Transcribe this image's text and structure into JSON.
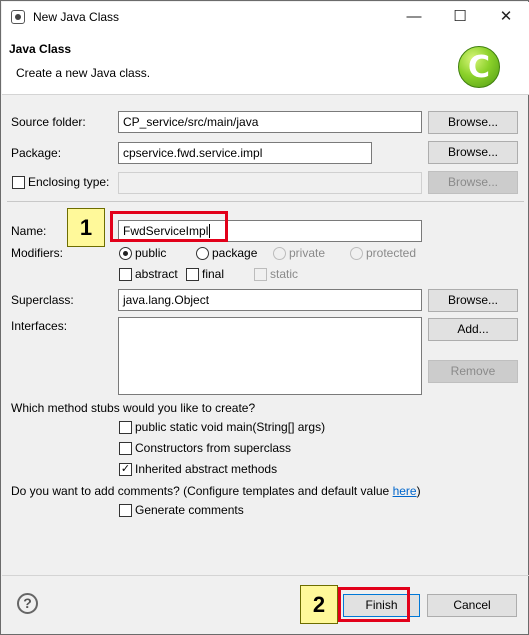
{
  "window": {
    "title": "New Java Class",
    "minimize": "—",
    "maximize": "☐",
    "close": "✕"
  },
  "header": {
    "title": "Java Class",
    "description": "Create a new Java class.",
    "badge_letter": "C"
  },
  "source_folder": {
    "label": "Source folder:",
    "value": "CP_service/src/main/java",
    "button": "Browse..."
  },
  "package": {
    "label": "Package:",
    "value": "cpservice.fwd.service.impl",
    "button": "Browse..."
  },
  "enclosing_type": {
    "label": "Enclosing type:",
    "value": "",
    "button": "Browse...",
    "checked": false
  },
  "name": {
    "label": "Name:",
    "value": "FwdServiceImpl"
  },
  "modifiers": {
    "label": "Modifiers:",
    "access": [
      "public",
      "package",
      "private",
      "protected"
    ],
    "selected": "public",
    "flags": [
      "abstract",
      "final",
      "static"
    ]
  },
  "superclass": {
    "label": "Superclass:",
    "value": "java.lang.Object",
    "button": "Browse..."
  },
  "interfaces": {
    "label": "Interfaces:",
    "add_button": "Add...",
    "remove_button": "Remove"
  },
  "method_stubs": {
    "question": "Which method stubs would you like to create?",
    "options": [
      {
        "label": "public static void main(String[] args)",
        "checked": false
      },
      {
        "label": "Constructors from superclass",
        "checked": false
      },
      {
        "label": "Inherited abstract methods",
        "checked": true
      }
    ]
  },
  "comments": {
    "question": "Do you want to add comments? (Configure templates and default value ",
    "link": "here",
    "question_end": ")",
    "option": {
      "label": "Generate comments",
      "checked": false
    }
  },
  "footer": {
    "help": "?",
    "finish": "Finish",
    "cancel": "Cancel"
  },
  "annotations": {
    "step1": "1",
    "step2": "2"
  },
  "colors": {
    "highlight": "#e2001a",
    "badge_bg": "#fff99a",
    "link": "#0066cc"
  }
}
